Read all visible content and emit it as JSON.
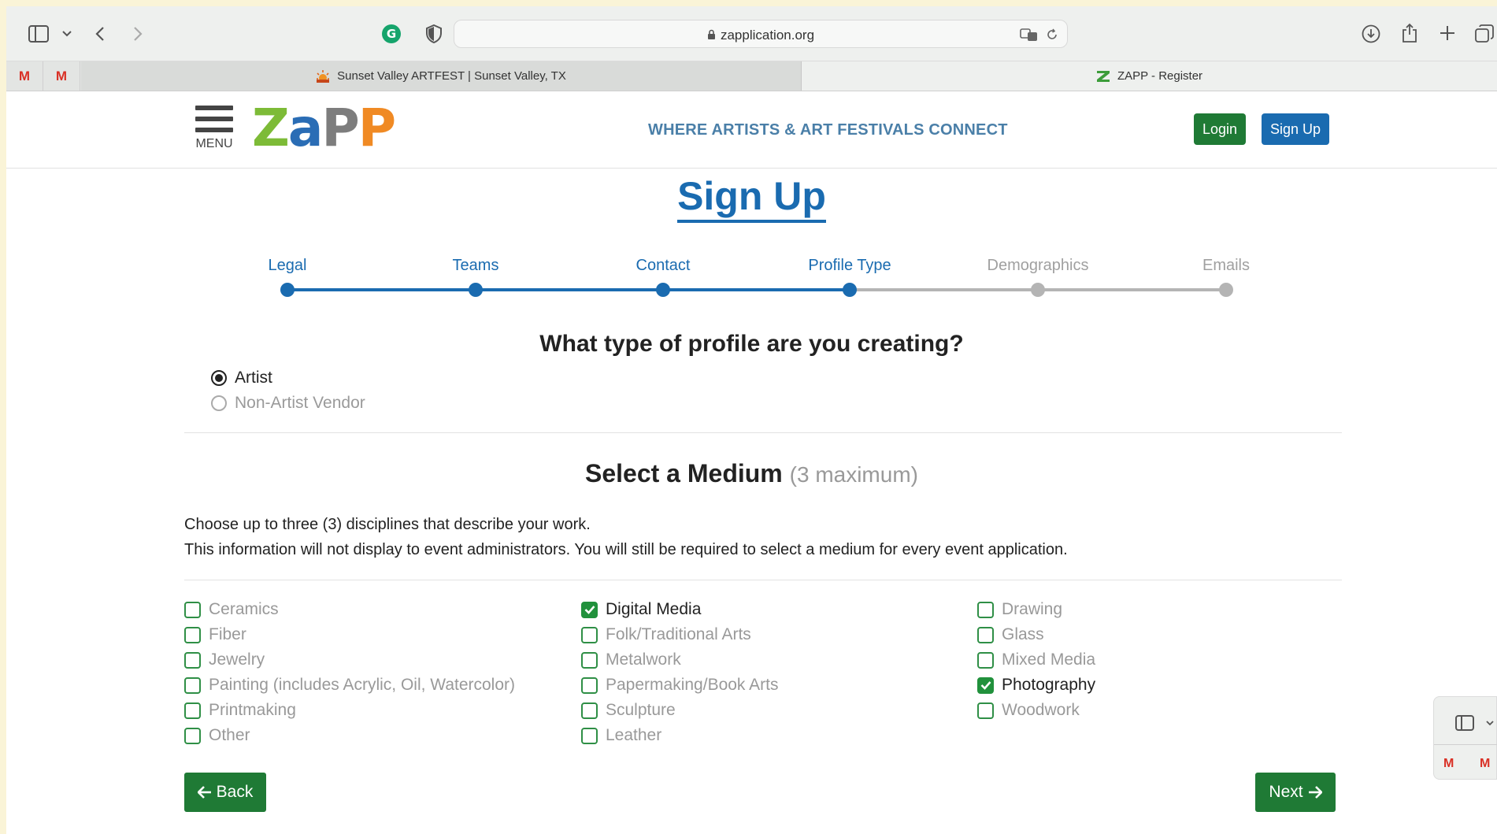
{
  "browser": {
    "url": "zapplication.org",
    "icons": [
      "sidebar-icon",
      "chevron-down-icon",
      "back-icon",
      "forward-icon",
      "grammarly-icon",
      "shield-icon",
      "translate-icon",
      "reload-icon",
      "download-icon",
      "share-icon",
      "new-tab-icon",
      "tabs-overview-icon"
    ],
    "pinned_tabs": [
      "M",
      "M"
    ],
    "tabs": [
      {
        "title": "Sunset Valley ARTFEST | Sunset Valley, TX",
        "active": false
      },
      {
        "title": "ZAPP - Register",
        "active": true
      }
    ]
  },
  "header": {
    "menu_label": "MENU",
    "logo_letters": [
      "Z",
      "a",
      "P",
      "P"
    ],
    "tagline": "WHERE ARTISTS & ART FESTIVALS CONNECT",
    "login_label": "Login",
    "signup_label": "Sign Up"
  },
  "page": {
    "title": "Sign Up",
    "steps": [
      {
        "label": "Legal",
        "complete": true
      },
      {
        "label": "Teams",
        "complete": true
      },
      {
        "label": "Contact",
        "complete": true
      },
      {
        "label": "Profile Type",
        "complete": true
      },
      {
        "label": "Demographics",
        "complete": false
      },
      {
        "label": "Emails",
        "complete": false
      }
    ],
    "question": "What type of profile are you creating?",
    "profile_options": [
      {
        "label": "Artist",
        "selected": true
      },
      {
        "label": "Non-Artist Vendor",
        "selected": false
      }
    ],
    "medium_title": "Select a Medium",
    "medium_note": "(3 maximum)",
    "instructions": [
      "Choose up to three (3) disciplines that describe your work.",
      "This information will not display to event administrators. You will still be required to select a medium for every event application."
    ],
    "mediums": [
      [
        {
          "label": "Ceramics",
          "checked": false
        },
        {
          "label": "Fiber",
          "checked": false
        },
        {
          "label": "Jewelry",
          "checked": false
        },
        {
          "label": "Painting (includes Acrylic, Oil, Watercolor)",
          "checked": false
        },
        {
          "label": "Printmaking",
          "checked": false
        },
        {
          "label": "Other",
          "checked": false
        }
      ],
      [
        {
          "label": "Digital Media",
          "checked": true
        },
        {
          "label": "Folk/Traditional Arts",
          "checked": false
        },
        {
          "label": "Metalwork",
          "checked": false
        },
        {
          "label": "Papermaking/Book Arts",
          "checked": false
        },
        {
          "label": "Sculpture",
          "checked": false
        },
        {
          "label": "Leather",
          "checked": false
        }
      ],
      [
        {
          "label": "Drawing",
          "checked": false
        },
        {
          "label": "Glass",
          "checked": false
        },
        {
          "label": "Mixed Media",
          "checked": false
        },
        {
          "label": "Photography",
          "checked": true
        },
        {
          "label": "Woodwork",
          "checked": false
        }
      ]
    ],
    "back_label": "Back",
    "next_label": "Next"
  },
  "colors": {
    "primary_blue": "#1a6bb0",
    "success_green": "#1f7a35",
    "inactive_gray": "#a9a9a9",
    "logo_z": "#7dbb37",
    "logo_a": "#2a6db5",
    "logo_p1": "#7d7d7d",
    "logo_p2": "#f08a24"
  }
}
